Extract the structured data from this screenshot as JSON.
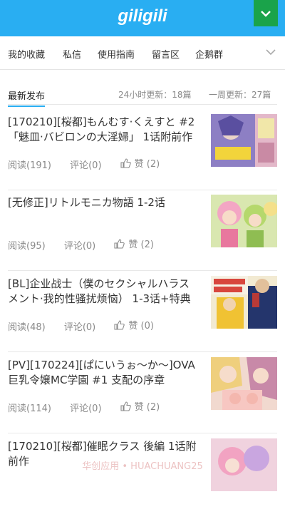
{
  "header": {
    "logo": "giligili"
  },
  "nav": {
    "items": [
      "我的收藏",
      "私信",
      "使用指南",
      "留言区",
      "企鹅群"
    ]
  },
  "section": {
    "title": "最新发布",
    "stat24": "24小时更新：18篇",
    "statWeek": "一周更新：27篇"
  },
  "articles": [
    {
      "title": "[170210][桜都]もんむす·くえすと #2「魅皿·バビロンの大淫婦」 1话附前作",
      "reads": "阅读(191)",
      "comments": "评论(0)",
      "likes": "赞 (2)"
    },
    {
      "title": "[无修正]リトルモニカ物語 1-2话",
      "reads": "阅读(95)",
      "comments": "评论(0)",
      "likes": "赞 (2)"
    },
    {
      "title": "[BL]企业战士（僕のセクシャルハラスメント·我的性骚扰烦恼） 1-3话+特典",
      "reads": "阅读(48)",
      "comments": "评论(0)",
      "likes": "赞 (0)"
    },
    {
      "title": "[PV][170224][ぱにいうぉ～か～]OVA 巨乳令嬢MC学園 #1 支配の序章",
      "reads": "阅读(114)",
      "comments": "评论(0)",
      "likes": "赞 (2)"
    },
    {
      "title": "[170210][桜都]催眠クラス 後編 1话附前作",
      "reads": "",
      "comments": "",
      "likes": ""
    }
  ],
  "watermark": "华创应用 • HUACHUANG25"
}
